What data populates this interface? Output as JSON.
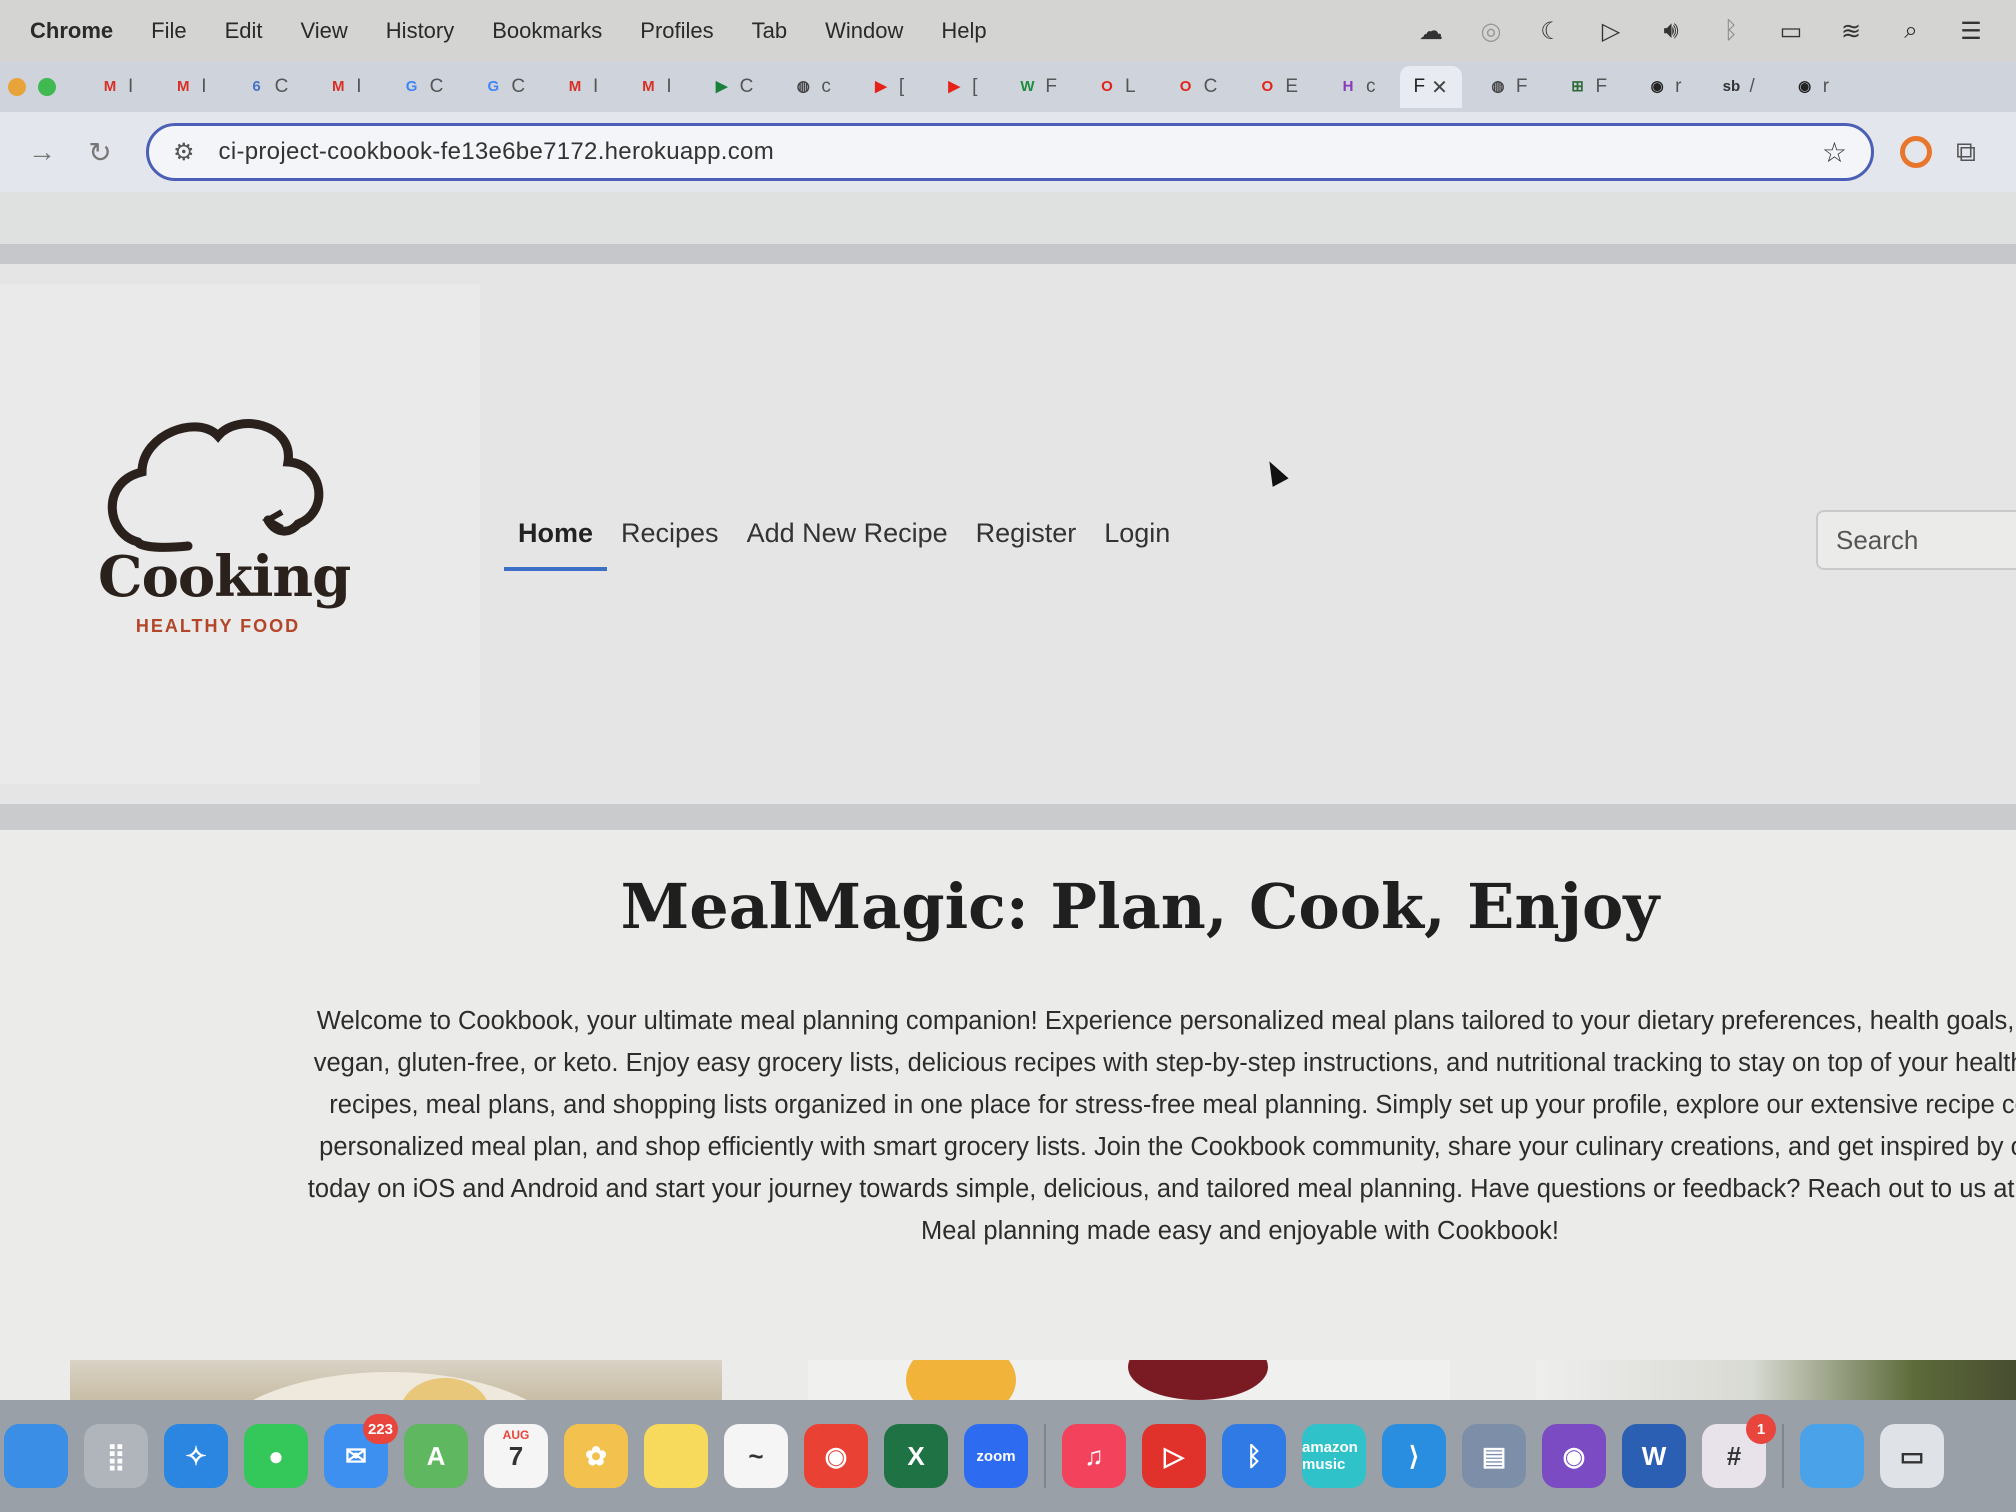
{
  "menubar": {
    "app": "Chrome",
    "items": [
      "File",
      "Edit",
      "View",
      "History",
      "Bookmarks",
      "Profiles",
      "Tab",
      "Window",
      "Help"
    ],
    "status_icons": [
      "cloud-icon",
      "fingerprint-icon",
      "moon-icon",
      "play-icon",
      "volume-icon",
      "bluetooth-icon",
      "battery-icon",
      "wifi-icon",
      "search-icon",
      "control-center-icon"
    ]
  },
  "tabs": [
    {
      "icon": "gmail-icon",
      "glyph": "M",
      "color": "#d93025",
      "label": "I"
    },
    {
      "icon": "gmail-icon",
      "glyph": "M",
      "color": "#d93025",
      "label": "I"
    },
    {
      "icon": "calendar-icon",
      "glyph": "6",
      "color": "#4a72c4",
      "label": "C"
    },
    {
      "icon": "gmail-icon",
      "glyph": "M",
      "color": "#d93025",
      "label": "I"
    },
    {
      "icon": "google-icon",
      "glyph": "G",
      "color": "#4285f4",
      "label": "C"
    },
    {
      "icon": "google-icon",
      "glyph": "G",
      "color": "#4285f4",
      "label": "C"
    },
    {
      "icon": "gmail-icon",
      "glyph": "M",
      "color": "#d93025",
      "label": "I"
    },
    {
      "icon": "gmail-icon",
      "glyph": "M",
      "color": "#d93025",
      "label": "I"
    },
    {
      "icon": "meet-icon",
      "glyph": "▶",
      "color": "#188038",
      "label": "C"
    },
    {
      "icon": "globe-icon",
      "glyph": "◍",
      "color": "#444",
      "label": "c"
    },
    {
      "icon": "youtube-icon",
      "glyph": "▶",
      "color": "#e62117",
      "label": "["
    },
    {
      "icon": "youtube-icon",
      "glyph": "▶",
      "color": "#e62117",
      "label": "["
    },
    {
      "icon": "w-icon",
      "glyph": "W",
      "color": "#1e8e3e",
      "label": "F"
    },
    {
      "icon": "opera-icon",
      "glyph": "O",
      "color": "#e2231a",
      "label": "L"
    },
    {
      "icon": "opera-icon",
      "glyph": "O",
      "color": "#e2231a",
      "label": "C"
    },
    {
      "icon": "opera-icon",
      "glyph": "O",
      "color": "#e2231a",
      "label": "E"
    },
    {
      "icon": "h-icon",
      "glyph": "H",
      "color": "#8a3ab9",
      "label": "c"
    },
    {
      "icon": "",
      "glyph": "",
      "color": "",
      "label": "F",
      "active": true
    },
    {
      "icon": "globe-icon",
      "glyph": "◍",
      "color": "#444",
      "label": "F"
    },
    {
      "icon": "grid-icon",
      "glyph": "⊞",
      "color": "#2f6b3a",
      "label": "F"
    },
    {
      "icon": "github-icon",
      "glyph": "◉",
      "color": "#222",
      "label": "r"
    },
    {
      "icon": "sb-icon",
      "glyph": "sb",
      "color": "#333",
      "label": "/"
    },
    {
      "icon": "github-icon",
      "glyph": "◉",
      "color": "#222",
      "label": "r"
    }
  ],
  "toolbar": {
    "url": "ci-project-cookbook-fe13e6be7172.herokuapp.com"
  },
  "site": {
    "logo_word": "Cooking",
    "logo_tagline": "HEALTHY FOOD",
    "nav": [
      "Home",
      "Recipes",
      "Add New Recipe",
      "Register",
      "Login"
    ],
    "nav_active": "Home",
    "search_placeholder": "Search"
  },
  "hero": {
    "title": "MealMagic: Plan, Cook, Enjoy",
    "lines": [
      "Welcome to Cookbook, your ultimate meal planning companion! Experience personalized meal plans tailored to your dietary preferences, health goals, and lifestyle,",
      "vegan, gluten-free, or keto. Enjoy easy grocery lists, delicious recipes with step-by-step instructions, and nutritional tracking to stay on top of your health goals. Keep",
      "recipes, meal plans, and shopping lists organized in one place for stress-free meal planning. Simply set up your profile, explore our extensive recipe collection, ge",
      "personalized meal plan, and shop efficiently with smart grocery lists. Join the Cookbook community, share your culinary creations, and get inspired by others. Down",
      "today on iOS and Android and start your journey towards simple, delicious, and tailored meal planning. Have questions or feedback? Reach out to us at support@coc",
      "Meal planning made easy and enjoyable with Cookbook!"
    ]
  },
  "dock": [
    {
      "name": "finder-icon",
      "glyph": "",
      "color": "#3a8ee6"
    },
    {
      "name": "launchpad-icon",
      "glyph": "⣿",
      "color": "#b0b4bb"
    },
    {
      "name": "safari-icon",
      "glyph": "✧",
      "color": "#2a86e0"
    },
    {
      "name": "messages-icon",
      "glyph": "●",
      "color": "#34c759"
    },
    {
      "name": "mail-icon",
      "glyph": "✉",
      "color": "#3d8ff0",
      "badge": "223"
    },
    {
      "name": "maps-icon",
      "glyph": "A",
      "color": "#5fb760"
    },
    {
      "name": "calendar-icon",
      "glyph": "7",
      "color": "#f5f5f5",
      "top": "AUG"
    },
    {
      "name": "photos-icon",
      "glyph": "✿",
      "color": "#f3c24e"
    },
    {
      "name": "notes-icon",
      "glyph": "",
      "color": "#f7d95c"
    },
    {
      "name": "freeform-icon",
      "glyph": "~",
      "color": "#f5f5f5"
    },
    {
      "name": "chrome-icon",
      "glyph": "◉",
      "color": "#e94235"
    },
    {
      "name": "excel-icon",
      "glyph": "X",
      "color": "#1f7244"
    },
    {
      "name": "zoom-icon",
      "glyph": "zoom",
      "color": "#2d6cf0"
    },
    {
      "name": "music-icon",
      "glyph": "♫",
      "color": "#f2425c"
    },
    {
      "name": "pdf-icon",
      "glyph": "▷",
      "color": "#e0322b"
    },
    {
      "name": "bluetooth-icon",
      "glyph": "ᛒ",
      "color": "#2f7ae5"
    },
    {
      "name": "amazon-music-icon",
      "glyph": "amazon music",
      "color": "#2fc3c9"
    },
    {
      "name": "vscode-icon",
      "glyph": "⟩",
      "color": "#2a8ee0"
    },
    {
      "name": "preview-icon",
      "glyph": "▤",
      "color": "#7c8ea8"
    },
    {
      "name": "github-desktop-icon",
      "glyph": "◉",
      "color": "#7b4bc4"
    },
    {
      "name": "word-icon",
      "glyph": "W",
      "color": "#2b5fb4"
    },
    {
      "name": "slack-icon",
      "glyph": "#",
      "color": "#e8e2ea",
      "badge": "1"
    },
    {
      "name": "folder-icon",
      "glyph": "",
      "color": "#4aa3e8"
    },
    {
      "name": "screen-icon",
      "glyph": "▭",
      "color": "#dfe2e6"
    }
  ]
}
